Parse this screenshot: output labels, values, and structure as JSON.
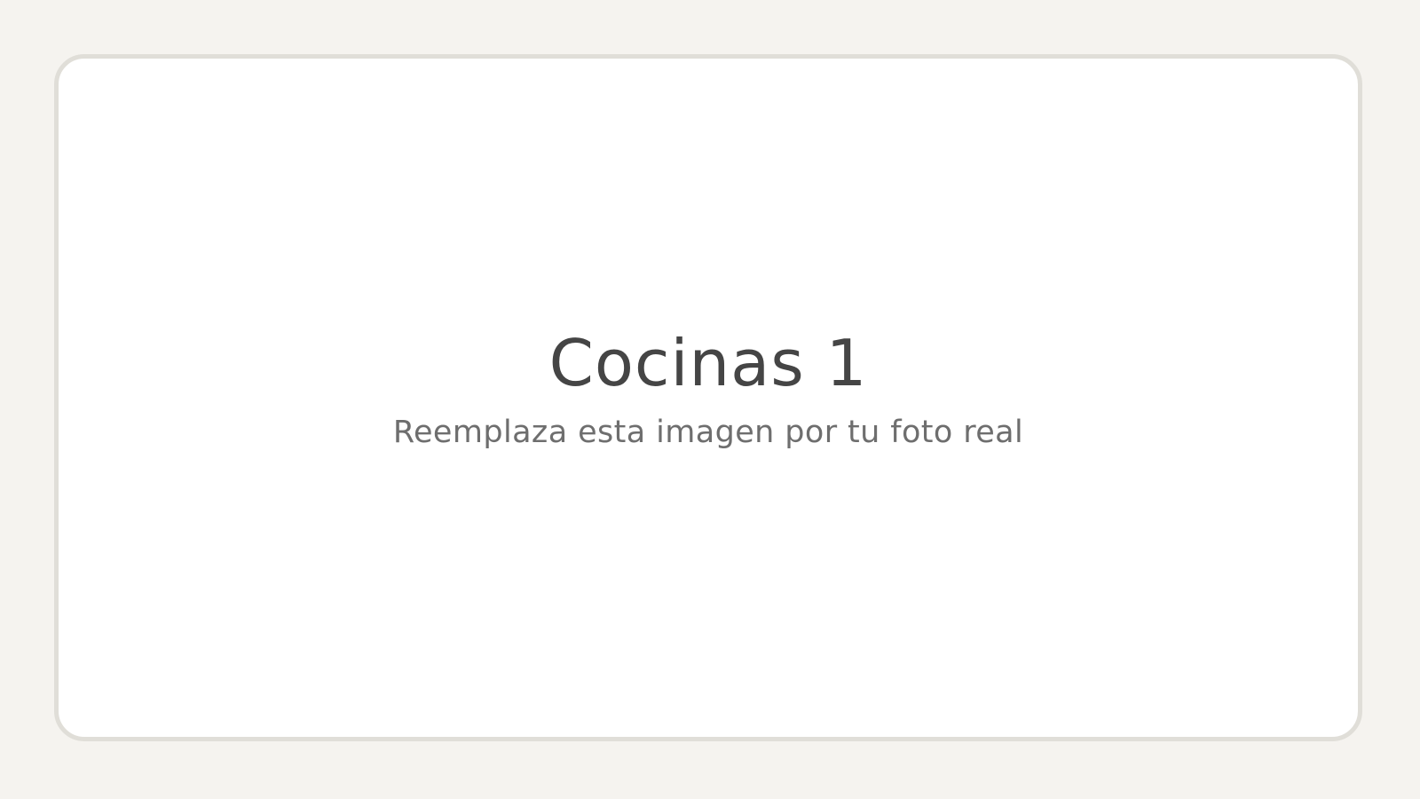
{
  "placeholder": {
    "title": "Cocinas 1",
    "subtitle": "Reemplaza esta imagen por tu foto real"
  },
  "colors": {
    "page_background": "#f5f3ef",
    "card_background": "#ffffff",
    "card_border": "#e0ded8",
    "title_text": "#454545",
    "subtitle_text": "#6e6e6e"
  }
}
